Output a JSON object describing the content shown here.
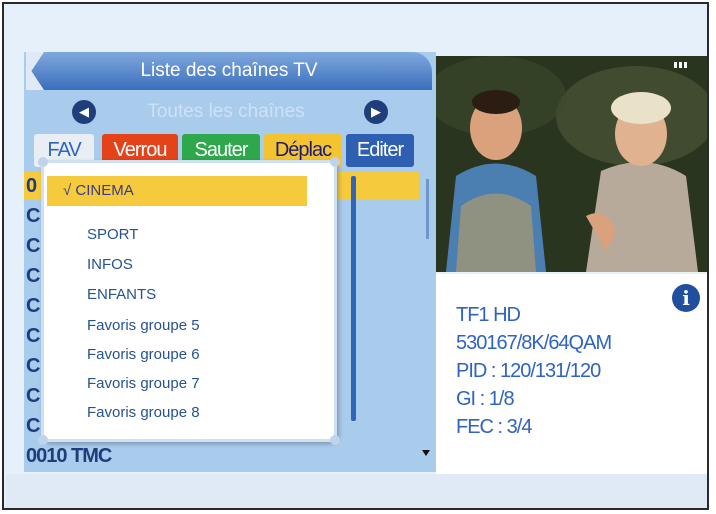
{
  "header": {
    "title": "Liste des chaînes TV"
  },
  "group_selector": {
    "label": "Toutes les chaînes",
    "prev_icon": "left-arrow-icon",
    "next_icon": "right-arrow-icon"
  },
  "tabs": [
    {
      "label": "FAV",
      "bg": "#e9eef5",
      "color": "#2e64c0"
    },
    {
      "label": "Verrou",
      "bg": "#e4431a",
      "color": "#ffffff"
    },
    {
      "label": "Sauter",
      "bg": "#2ea84a",
      "color": "#ffffff"
    },
    {
      "label": "Déplac",
      "bg": "#f4c430",
      "color": "#1b1b7a"
    },
    {
      "label": "Editer",
      "bg": "#2f5fb0",
      "color": "#ffffff"
    }
  ],
  "channels": [
    {
      "label": "0"
    },
    {
      "label": "C"
    },
    {
      "label": "C"
    },
    {
      "label": "C"
    },
    {
      "label": "C"
    },
    {
      "label": "C"
    },
    {
      "label": "C"
    },
    {
      "label": "C"
    },
    {
      "label": "C"
    },
    {
      "label": "0010 TMC"
    }
  ],
  "favorites_menu": {
    "items": [
      {
        "label": "√ CINEMA",
        "selected": true
      },
      {
        "label": "SPORT"
      },
      {
        "label": "INFOS"
      },
      {
        "label": "ENFANTS"
      },
      {
        "label": "Favoris groupe 5"
      },
      {
        "label": "Favoris groupe 6"
      },
      {
        "label": "Favoris groupe 7"
      },
      {
        "label": "Favoris groupe 8"
      }
    ]
  },
  "info": {
    "channel_name": "TF1 HD",
    "frequency": "530167/8K/64QAM",
    "pid": "PID : 120/131/120",
    "gi": "GI : 1/8",
    "fec": "FEC : 3/4",
    "info_icon": "info-icon"
  },
  "colors": {
    "accent": "#2e64c0",
    "panel": "#a9cbec",
    "highlight": "#f5cb3d"
  }
}
